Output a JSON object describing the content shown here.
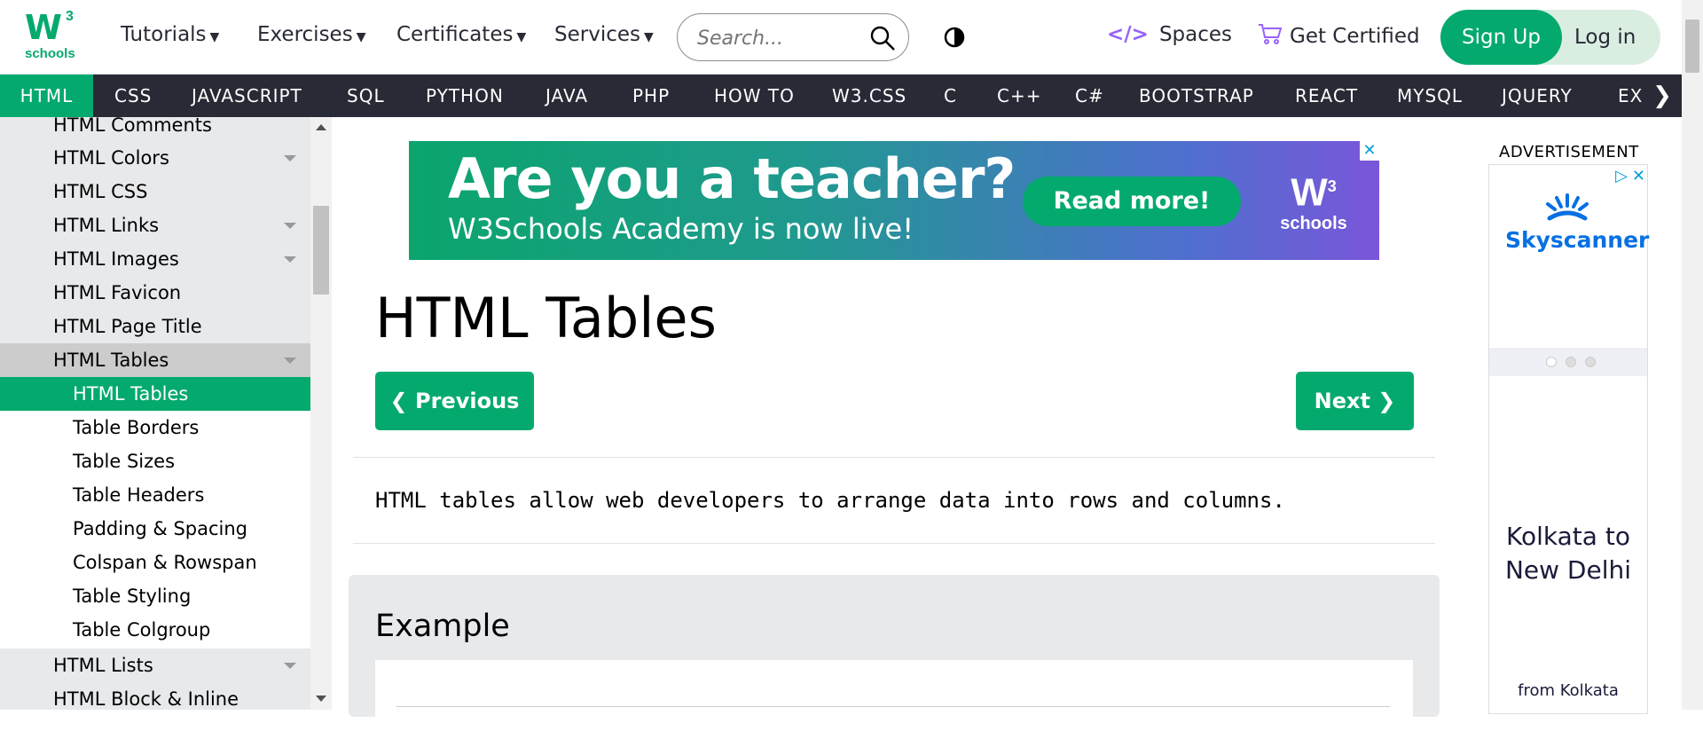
{
  "logo": {
    "main": "W",
    "sup": "3",
    "sub": "schools"
  },
  "header": {
    "nav": [
      {
        "label": "Tutorials"
      },
      {
        "label": "Exercises"
      },
      {
        "label": "Certificates"
      },
      {
        "label": "Services"
      }
    ],
    "search_placeholder": "Search...",
    "spaces_icon": "</>",
    "spaces_label": "Spaces",
    "certified_label": "Get Certified",
    "signup_label": "Sign Up",
    "login_label": "Log in"
  },
  "topnav": [
    "HTML",
    "CSS",
    "JAVASCRIPT",
    "SQL",
    "PYTHON",
    "JAVA",
    "PHP",
    "HOW TO",
    "W3.CSS",
    "C",
    "C++",
    "C#",
    "BOOTSTRAP",
    "REACT",
    "MYSQL",
    "JQUERY",
    "EX"
  ],
  "topnav_more": "❯",
  "sidebar": {
    "items": [
      {
        "label": "HTML Comments"
      },
      {
        "label": "HTML Colors"
      },
      {
        "label": "HTML CSS"
      },
      {
        "label": "HTML Links"
      },
      {
        "label": "HTML Images"
      },
      {
        "label": "HTML Favicon"
      },
      {
        "label": "HTML Page Title"
      },
      {
        "label": "HTML Tables"
      },
      {
        "label": "HTML Tables"
      },
      {
        "label": "Table Borders"
      },
      {
        "label": "Table Sizes"
      },
      {
        "label": "Table Headers"
      },
      {
        "label": "Padding & Spacing"
      },
      {
        "label": "Colspan & Rowspan"
      },
      {
        "label": "Table Styling"
      },
      {
        "label": "Table Colgroup"
      },
      {
        "label": "HTML Lists"
      },
      {
        "label": "HTML Block & Inline"
      }
    ]
  },
  "ad_banner": {
    "headline": "Are you a teacher?",
    "subline": "W3Schools Academy is now live!",
    "button": "Read more!",
    "logo_main": "W",
    "logo_sup": "3",
    "logo_sub": "schools",
    "close": "✕"
  },
  "main": {
    "title": "HTML Tables",
    "prev_label": "❮ Previous",
    "next_label": "Next ❯",
    "intro": "HTML tables allow web developers to arrange data into rows and columns.",
    "example_heading": "Example"
  },
  "right_ad": {
    "label": "ADVERTISEMENT",
    "brand": "Skyscanner",
    "route": "Kolkata to New Delhi",
    "from": "from Kolkata",
    "icons": "▷ ✕"
  },
  "colors": {
    "accent": "#04AA6D",
    "nav_bg": "#282A35",
    "sidebar_bg": "#E7E9EB"
  }
}
